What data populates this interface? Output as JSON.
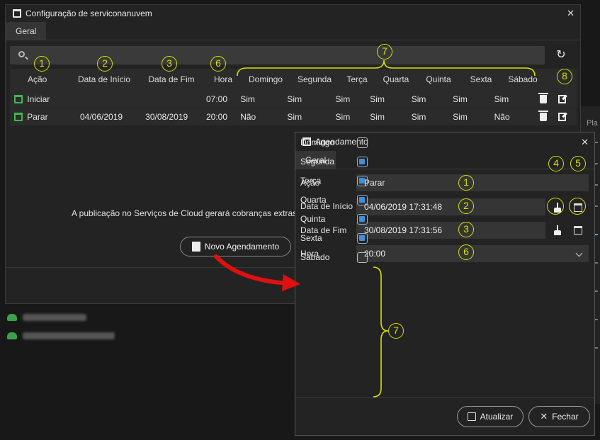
{
  "main": {
    "title": "Configuração de serviconanuvem",
    "tab": "Geral",
    "columns": {
      "acao": "Ação",
      "inicio": "Data de Início",
      "fim": "Data de Fim",
      "hora": "Hora",
      "dom": "Domingo",
      "seg": "Segunda",
      "ter": "Terça",
      "qua": "Quarta",
      "qui": "Quinta",
      "sex": "Sexta",
      "sab": "Sábado"
    },
    "rows": [
      {
        "acao": "Iniciar",
        "inicio": "",
        "fim": "",
        "hora": "07:00",
        "dom": "Sim",
        "seg": "Sim",
        "ter": "Sim",
        "qua": "Sim",
        "qui": "Sim",
        "sex": "Sim",
        "sab": "Sim"
      },
      {
        "acao": "Parar",
        "inicio": "04/06/2019",
        "fim": "30/08/2019",
        "hora": "20:00",
        "dom": "Não",
        "seg": "Sim",
        "ter": "Sim",
        "qua": "Sim",
        "qui": "Sim",
        "sex": "Sim",
        "sab": "Não"
      }
    ],
    "notice": "A publicação no Serviços de Cloud gerará cobranças extras",
    "new_button": "Novo Agendamento"
  },
  "sched": {
    "title": "Agendamento",
    "tab": "Geral",
    "acao_label": "Ação",
    "acao_value": "Parar",
    "inicio_label": "Data de Início",
    "inicio_value": "04/06/2019 17:31:48",
    "fim_label": "Data de Fim",
    "fim_value": "30/08/2019 17:31:56",
    "hora_label": "Hora",
    "hora_value": "20:00",
    "days": [
      {
        "label": "Domingo",
        "checked": false
      },
      {
        "label": "Segunda",
        "checked": true
      },
      {
        "label": "Terça",
        "checked": true
      },
      {
        "label": "Quarta",
        "checked": true
      },
      {
        "label": "Quinta",
        "checked": true
      },
      {
        "label": "Sexta",
        "checked": true
      },
      {
        "label": "Sábado",
        "checked": false
      }
    ],
    "update_button": "Atualizar",
    "close_button": "Fechar"
  },
  "background": {
    "side_text": "Pla"
  },
  "annotations": [
    "1",
    "2",
    "3",
    "6",
    "7",
    "8",
    "4",
    "5",
    "1",
    "2",
    "3",
    "6",
    "7"
  ],
  "colors": {
    "accent_annotation": "#d8e000",
    "checkbox_on": "#3d8fe0",
    "calendar_green": "#3fb950",
    "arrow_red": "#e01010"
  }
}
